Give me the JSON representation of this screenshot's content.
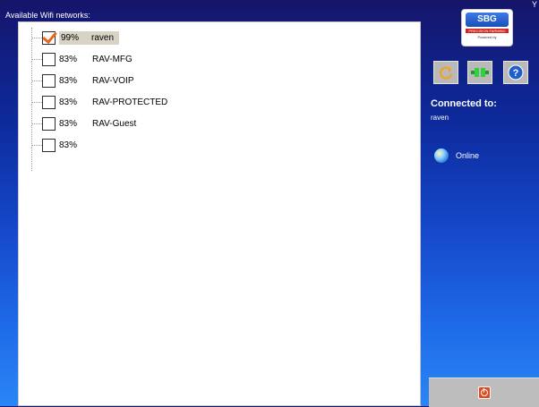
{
  "header": {
    "title": "Available Wifi networks:"
  },
  "networks": [
    {
      "signal": "99%",
      "ssid": "raven",
      "checked": true,
      "selected": true
    },
    {
      "signal": "83%",
      "ssid": "RAV-MFG",
      "checked": false,
      "selected": false
    },
    {
      "signal": "83%",
      "ssid": "RAV-VOIP",
      "checked": false,
      "selected": false
    },
    {
      "signal": "83%",
      "ssid": "RAV-PROTECTED",
      "checked": false,
      "selected": false
    },
    {
      "signal": "83%",
      "ssid": "RAV-Guest",
      "checked": false,
      "selected": false
    },
    {
      "signal": "83%",
      "ssid": "",
      "checked": false,
      "selected": false
    }
  ],
  "sidebar": {
    "logo": {
      "brand": "SBG",
      "tagline": "PRECISION FARMING",
      "powered_by": "Powered by"
    },
    "buttons": [
      {
        "icon": "refresh-icon"
      },
      {
        "icon": "network-connector-icon"
      },
      {
        "icon": "help-icon",
        "glyph": "?"
      }
    ],
    "connected_label": "Connected to:",
    "connected_value": "raven",
    "status": {
      "icon": "globe-icon",
      "text": "Online"
    },
    "power": {
      "icon": "power-icon"
    },
    "close_glyph": "Y"
  },
  "colors": {
    "accent_check": "#e8651a",
    "panel_bg": "#ffffff",
    "power": "#e54a1f"
  }
}
